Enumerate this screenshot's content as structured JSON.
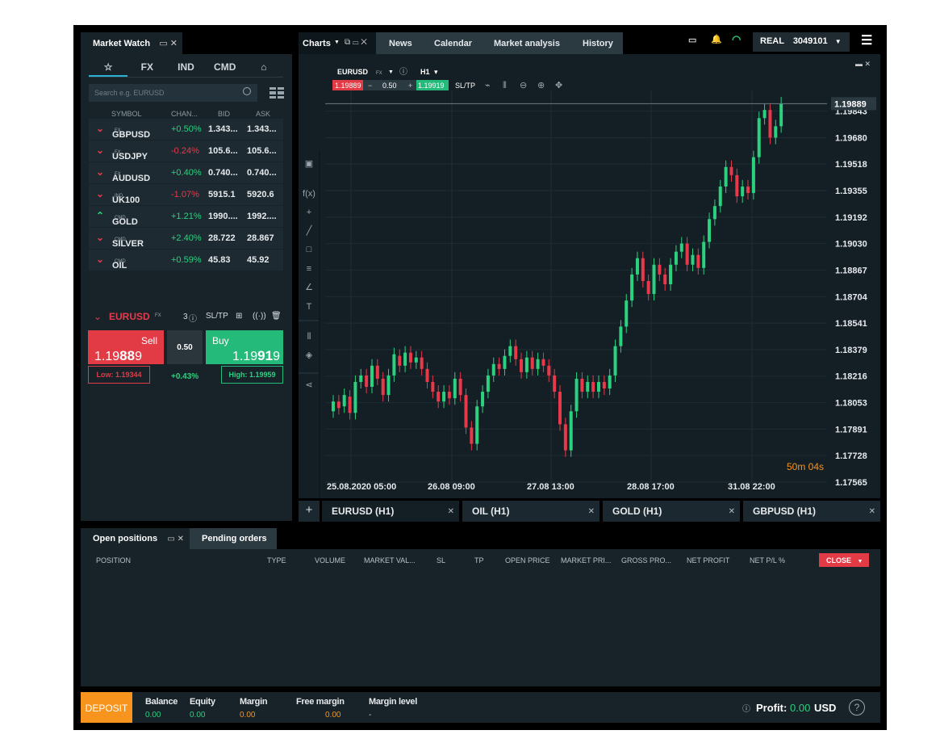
{
  "market_watch": {
    "title": "Market Watch",
    "tabs": [
      "☆",
      "FX",
      "IND",
      "CMD",
      "⌂"
    ],
    "search_placeholder": "Search e.g. EURUSD",
    "columns": [
      "SYMBOL",
      "CHAN...",
      "BID",
      "ASK"
    ],
    "rows": [
      {
        "arrow": "v",
        "symbol": "GBPUSD",
        "type": "FX",
        "change": "+0.50%",
        "bid": "1.343...",
        "ask": "1.343...",
        "dir": "up"
      },
      {
        "arrow": "v",
        "symbol": "USDJPY",
        "type": "FX",
        "change": "-0.24%",
        "bid": "105.6...",
        "ask": "105.6...",
        "dir": "dn"
      },
      {
        "arrow": "v",
        "symbol": "AUDUSD",
        "type": "FX",
        "change": "+0.40%",
        "bid": "0.740...",
        "ask": "0.740...",
        "dir": "up"
      },
      {
        "arrow": "v",
        "symbol": "UK100",
        "type": "IND",
        "change": "-1.07%",
        "bid": "5915.1",
        "ask": "5920.6",
        "dir": "dn"
      },
      {
        "arrow": "^",
        "symbol": "GOLD",
        "type": "CMD",
        "change": "+1.21%",
        "bid": "1990....",
        "ask": "1992....",
        "dir": "up"
      },
      {
        "arrow": "v",
        "symbol": "SILVER",
        "type": "CMD",
        "change": "+2.40%",
        "bid": "28.722",
        "ask": "28.867",
        "dir": "up"
      },
      {
        "arrow": "v",
        "symbol": "OIL",
        "type": "CMD",
        "change": "+0.59%",
        "bid": "45.83",
        "ask": "45.92",
        "dir": "up"
      }
    ],
    "trade": {
      "symbol": "EURUSD",
      "type": "FX",
      "count": "3",
      "sltp": "SL/TP",
      "sell_label": "Sell",
      "sell_price_a": "1.19",
      "sell_price_b": "88",
      "sell_price_c": "9",
      "buy_label": "Buy",
      "buy_price_a": "1.19",
      "buy_price_b": "91",
      "buy_price_c": "9",
      "volume": "0.50",
      "low": "Low: 1.19344",
      "high": "High: 1.19959",
      "change": "+0.43%"
    }
  },
  "topbar": {
    "charts": "Charts",
    "tabs": [
      "News",
      "Calendar",
      "Market analysis",
      "History"
    ]
  },
  "account": {
    "mode": "REAL",
    "number": "3049101"
  },
  "chart_toolbar": {
    "symbol": "EURUSD",
    "type": "FX",
    "timeframe": "H1",
    "sell": "1.19889",
    "volume": "0.50",
    "buy": "1.19919",
    "sltp": "SL/TP"
  },
  "chart_data": {
    "type": "candlestick",
    "ticks_y": [
      "1.19843",
      "1.19680",
      "1.19518",
      "1.19355",
      "1.19192",
      "1.19030",
      "1.18867",
      "1.18704",
      "1.18541",
      "1.18379",
      "1.18216",
      "1.18053",
      "1.17891",
      "1.17728",
      "1.17565"
    ],
    "current_price": "1.19889",
    "ticks_x": [
      "25.08.2020 05:00",
      "26.08 09:00",
      "27.08 13:00",
      "28.08 17:00",
      "31.08 22:00"
    ],
    "countdown": "50m 04s",
    "ylim": [
      1.17565,
      1.1997
    ],
    "candles": [
      [
        1.18,
        1.1806
      ],
      [
        1.1806,
        1.1802
      ],
      [
        1.1803,
        1.181
      ],
      [
        1.1809,
        1.1799
      ],
      [
        1.1799,
        1.1818
      ],
      [
        1.1818,
        1.1822
      ],
      [
        1.1822,
        1.1815
      ],
      [
        1.1815,
        1.1828
      ],
      [
        1.1828,
        1.182
      ],
      [
        1.182,
        1.181
      ],
      [
        1.181,
        1.1822
      ],
      [
        1.1822,
        1.1835
      ],
      [
        1.1834,
        1.1828
      ],
      [
        1.1828,
        1.1836
      ],
      [
        1.1836,
        1.183
      ],
      [
        1.183,
        1.1833
      ],
      [
        1.1833,
        1.1826
      ],
      [
        1.1826,
        1.1818
      ],
      [
        1.1818,
        1.1812
      ],
      [
        1.1812,
        1.1806
      ],
      [
        1.1806,
        1.1812
      ],
      [
        1.1812,
        1.1808
      ],
      [
        1.1808,
        1.182
      ],
      [
        1.182,
        1.181
      ],
      [
        1.181,
        1.179
      ],
      [
        1.179,
        1.178
      ],
      [
        1.178,
        1.1803
      ],
      [
        1.1803,
        1.1812
      ],
      [
        1.1812,
        1.1822
      ],
      [
        1.1822,
        1.1829
      ],
      [
        1.1829,
        1.1826
      ],
      [
        1.1826,
        1.1834
      ],
      [
        1.1834,
        1.184
      ],
      [
        1.184,
        1.1832
      ],
      [
        1.1832,
        1.1824
      ],
      [
        1.1824,
        1.1833
      ],
      [
        1.1833,
        1.1826
      ],
      [
        1.1826,
        1.1832
      ],
      [
        1.1832,
        1.1828
      ],
      [
        1.1828,
        1.1822
      ],
      [
        1.1822,
        1.1812
      ],
      [
        1.1812,
        1.1792
      ],
      [
        1.1792,
        1.1776
      ],
      [
        1.1776,
        1.18
      ],
      [
        1.18,
        1.182
      ],
      [
        1.182,
        1.1812
      ],
      [
        1.1812,
        1.1818
      ],
      [
        1.1818,
        1.1812
      ],
      [
        1.1812,
        1.1818
      ],
      [
        1.1818,
        1.1814
      ],
      [
        1.1814,
        1.1822
      ],
      [
        1.1822,
        1.184
      ],
      [
        1.184,
        1.1852
      ],
      [
        1.1852,
        1.1868
      ],
      [
        1.1868,
        1.1884
      ],
      [
        1.1884,
        1.1894
      ],
      [
        1.1894,
        1.188
      ],
      [
        1.188,
        1.1872
      ],
      [
        1.1872,
        1.189
      ],
      [
        1.189,
        1.1884
      ],
      [
        1.1884,
        1.1878
      ],
      [
        1.1878,
        1.189
      ],
      [
        1.189,
        1.1898
      ],
      [
        1.1898,
        1.1903
      ],
      [
        1.1903,
        1.189
      ],
      [
        1.189,
        1.1896
      ],
      [
        1.1896,
        1.1888
      ],
      [
        1.1888,
        1.1904
      ],
      [
        1.1904,
        1.1918
      ],
      [
        1.1918,
        1.1926
      ],
      [
        1.1926,
        1.1938
      ],
      [
        1.1938,
        1.195
      ],
      [
        1.195,
        1.1945
      ],
      [
        1.1945,
        1.1932
      ],
      [
        1.1932,
        1.1938
      ],
      [
        1.1938,
        1.1934
      ],
      [
        1.1934,
        1.1956
      ],
      [
        1.1956,
        1.198
      ],
      [
        1.198,
        1.1985
      ],
      [
        1.1985,
        1.1968
      ],
      [
        1.1968,
        1.1975
      ],
      [
        1.1975,
        1.1989
      ]
    ]
  },
  "chart_tabs": [
    {
      "label": "EURUSD (H1)"
    },
    {
      "label": "OIL (H1)"
    },
    {
      "label": "GOLD (H1)"
    },
    {
      "label": "GBPUSD (H1)"
    }
  ],
  "positions": {
    "tab_open": "Open positions",
    "tab_pending": "Pending orders",
    "columns": [
      "POSITION",
      "TYPE",
      "VOLUME",
      "MARKET VAL...",
      "SL",
      "TP",
      "OPEN PRICE",
      "MARKET PRI...",
      "GROSS PRO...",
      "NET PROFIT",
      "NET P/L %"
    ],
    "close": "CLOSE"
  },
  "footer": {
    "deposit": "DEPOSIT",
    "balance_label": "Balance",
    "balance": "0.00",
    "equity_label": "Equity",
    "equity": "0.00",
    "margin_label": "Margin",
    "margin": "0.00",
    "free_margin_label": "Free margin",
    "free_margin": "0.00",
    "margin_level_label": "Margin level",
    "margin_level": "-",
    "profit_label": "Profit:",
    "profit": "0.00",
    "currency": "USD"
  },
  "colors": {
    "up": "#2bd17f",
    "down": "#e8394a",
    "accent": "#2bb0d6",
    "deposit": "#f7941d"
  }
}
